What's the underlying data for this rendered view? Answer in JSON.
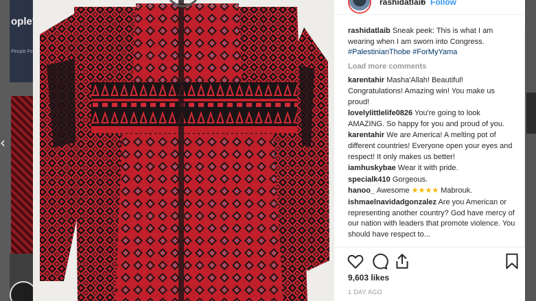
{
  "post": {
    "username": "rashidatlaib",
    "dot": "•",
    "follow_label": "Follow",
    "likes": "9,603 likes",
    "timestamp": "1 DAY AGO",
    "load_more": "Load more comments"
  },
  "caption": {
    "user": "rashidatlaib",
    "text": "Sneak peek: This is what I am wearing when I am sworn into Congress.",
    "hashtags": "#PalestinianThobe #ForMyYama"
  },
  "comments": [
    {
      "user": "karentahir",
      "text": "Masha'Allah! Beautiful! Congratulations! Amazing win! You make us proud!"
    },
    {
      "user": "lovelylittlelife0826",
      "text": "You're going to look AMAZING. So happy for you and proud of you."
    },
    {
      "user": "karentahir",
      "text": "We are America! A melting pot of different countries! Everyone open your eyes and respect! It only makes us better!"
    },
    {
      "user": "iamhuskybae",
      "text": "Wear it with pride."
    },
    {
      "user": "specialk410",
      "text": "Gorgeous."
    },
    {
      "user": "hanoo_",
      "text": "Awesome",
      "stars": "★★★★",
      "after": "Mabrouk."
    },
    {
      "user": "ishmaelnavidadgonzalez",
      "text": "Are you American or representing another country? God have mercy of our nation with leaders that promote violence. You should have respect to..."
    }
  ],
  "background": {
    "thumb_text": "ople's TFORM",
    "thumb_small": "People Fe"
  },
  "icons": [
    "heart-icon",
    "comment-icon",
    "share-icon",
    "bookmark-icon"
  ],
  "colors": {
    "link_blue": "#3897f0",
    "hashtag": "#003569",
    "muted": "#999999",
    "thobe_red": "#c4202c",
    "thobe_dark": "#1a1416"
  }
}
